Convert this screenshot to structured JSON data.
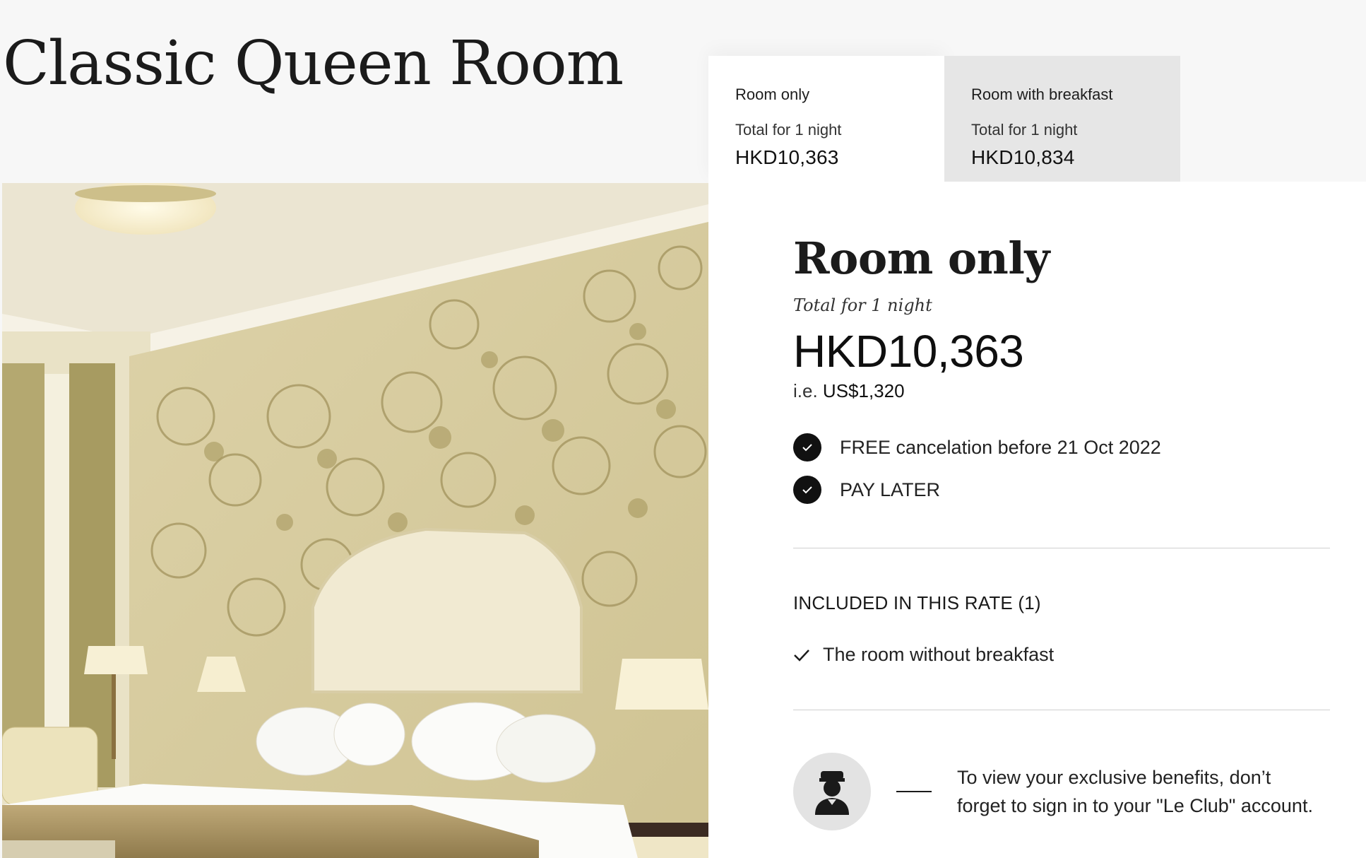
{
  "room": {
    "title": "Classic Queen Room"
  },
  "tabs": [
    {
      "name": "Room only",
      "sub": "Total for 1 night",
      "price": "HKD10,363",
      "active": true
    },
    {
      "name": "Room with breakfast",
      "sub": "Total for 1 night",
      "price": "HKD10,834",
      "active": false
    }
  ],
  "rate": {
    "title": "Room only",
    "total_label": "Total for 1 night",
    "price": "HKD10,363",
    "converted_prefix": "i.e.",
    "converted_value": "US$1,320",
    "conditions": [
      {
        "text": "FREE cancelation before 21 Oct 2022",
        "icon": "check-icon"
      },
      {
        "text": "PAY LATER",
        "icon": "check-icon"
      }
    ],
    "included_title": "INCLUDED IN THIS RATE (1)",
    "included_items": [
      {
        "text": "The room without breakfast",
        "icon": "check-icon"
      }
    ],
    "club_message": "To view your exclusive benefits, don’t forget to sign in to your \"Le Club\" account.",
    "club_icon": "concierge-icon"
  },
  "colors": {
    "active_tab": "#ffffff",
    "inactive_tab": "#e6e6e6",
    "check_circle": "#111111",
    "page_bg": "#f7f7f7"
  }
}
